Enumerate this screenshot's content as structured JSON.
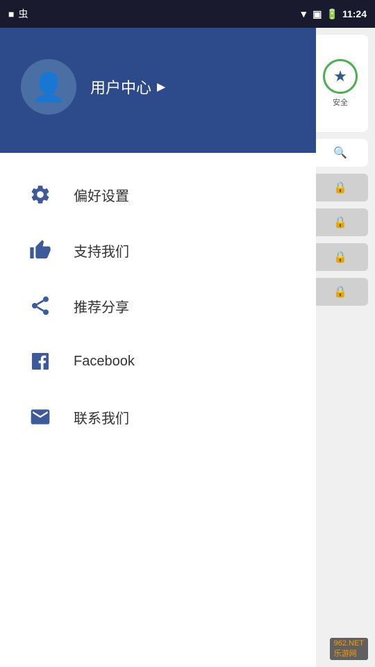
{
  "statusBar": {
    "time": "11:24",
    "leftIcons": [
      "■",
      "虫"
    ]
  },
  "drawer": {
    "header": {
      "userCenter": "用户中心",
      "arrowIcon": "▶"
    },
    "menuItems": [
      {
        "id": "preferences",
        "label": "偏好设置",
        "iconType": "gear"
      },
      {
        "id": "support",
        "label": "支持我们",
        "iconType": "thumbsup"
      },
      {
        "id": "share",
        "label": "推荐分享",
        "iconType": "share"
      },
      {
        "id": "facebook",
        "label": "Facebook",
        "iconType": "facebook"
      },
      {
        "id": "contact",
        "label": "联系我们",
        "iconType": "mail"
      }
    ]
  },
  "rightPanel": {
    "safeLabel": "安全",
    "searchIcon": "🔍"
  },
  "watermark": {
    "prefix": "962",
    "suffix": ".NET",
    "site": "乐游网"
  }
}
